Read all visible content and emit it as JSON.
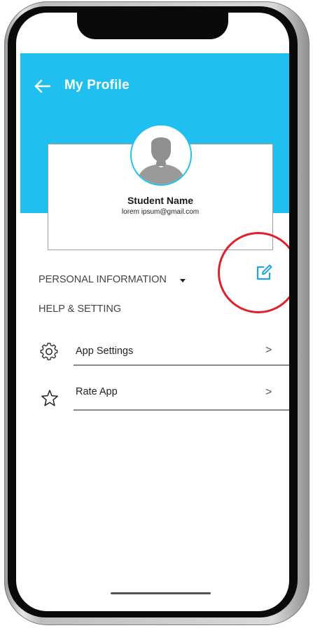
{
  "header": {
    "title": "My Profile",
    "accent_color": "#1fc0ef"
  },
  "profile": {
    "name": "Student Name",
    "email": "lorem ipsum@gmail.com"
  },
  "sections": {
    "personal_info": "PERSONAL INFORMATION",
    "help_setting": "HELP & SETTING"
  },
  "menu": [
    {
      "label": "App Settings",
      "icon": "gear-icon",
      "chevron": ">"
    },
    {
      "label": "Rate App",
      "icon": "star-icon",
      "chevron": ">"
    }
  ],
  "annotation": {
    "highlight_color": "#e0202a"
  }
}
